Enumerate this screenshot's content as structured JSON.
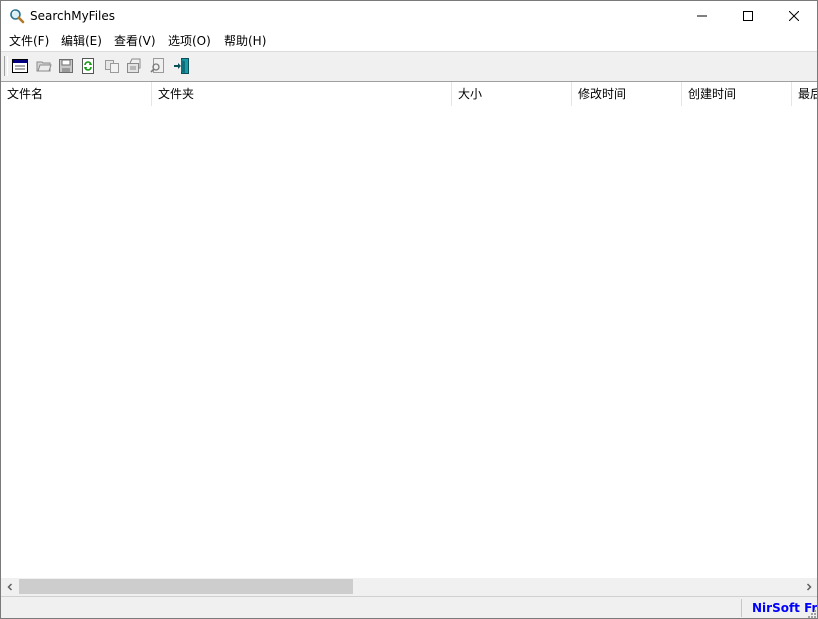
{
  "window": {
    "title": "SearchMyFiles"
  },
  "menu": [
    {
      "label": "文件(F)"
    },
    {
      "label": "编辑(E)"
    },
    {
      "label": "查看(V)"
    },
    {
      "label": "选项(O)"
    },
    {
      "label": "帮助(H)"
    }
  ],
  "toolbar": {
    "buttons": [
      {
        "icon": "search-options-icon"
      },
      {
        "icon": "open-folder-icon"
      },
      {
        "icon": "save-icon"
      },
      {
        "icon": "refresh-icon"
      },
      {
        "icon": "copy-icon"
      },
      {
        "icon": "properties-icon"
      },
      {
        "icon": "find-icon"
      },
      {
        "icon": "exit-icon"
      }
    ]
  },
  "list": {
    "columns": [
      "文件名",
      "文件夹",
      "大小",
      "修改时间",
      "创建时间",
      "最后访问时间"
    ],
    "rows": []
  },
  "statusbar": {
    "text": "",
    "link": "NirSoft Freeware",
    "link_color": "#0000ff"
  }
}
